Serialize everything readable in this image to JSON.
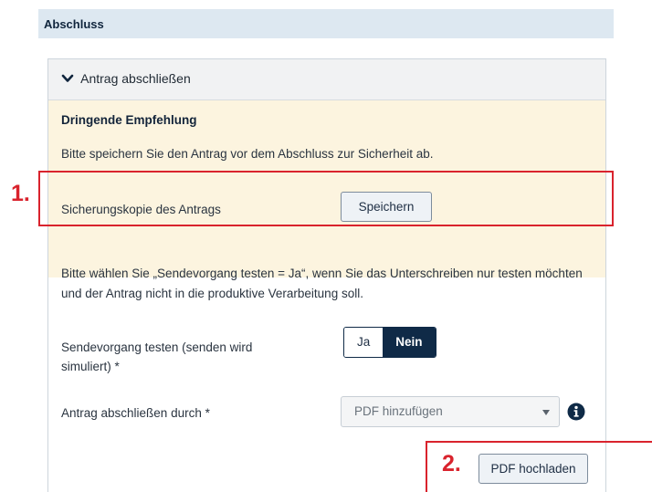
{
  "section": {
    "title": "Abschluss"
  },
  "panel": {
    "title": "Antrag abschließen",
    "expanded_icon": "chevron-down-icon"
  },
  "alert": {
    "title": "Dringende Empfehlung",
    "text": "Bitte speichern Sie den Antrag vor dem Abschluss zur Sicherheit ab.",
    "backup_label": "Sicherungskopie des Antrags",
    "save_button": "Speichern"
  },
  "info": {
    "text": "Bitte wählen Sie „Sendevorgang testen = Ja“, wenn Sie das Unterschreiben nur testen möchten und der Antrag nicht in die produktive Verarbeitung soll."
  },
  "test_send": {
    "label": "Sendevorgang testen (senden wird simuliert) *",
    "options": [
      "Ja",
      "Nein"
    ],
    "selected": "Nein"
  },
  "close_by": {
    "label": "Antrag abschließen durch *",
    "selected_value": "PDF hinzufügen",
    "info_icon": "info-icon"
  },
  "upload": {
    "button": "PDF hochladen"
  },
  "callouts": {
    "first": "1.",
    "second": "2.",
    "color": "#d9232d"
  },
  "colors": {
    "header_bg": "#dde8f1",
    "alert_bg": "#fcf4df",
    "toggle_active": "#0f2a47"
  }
}
